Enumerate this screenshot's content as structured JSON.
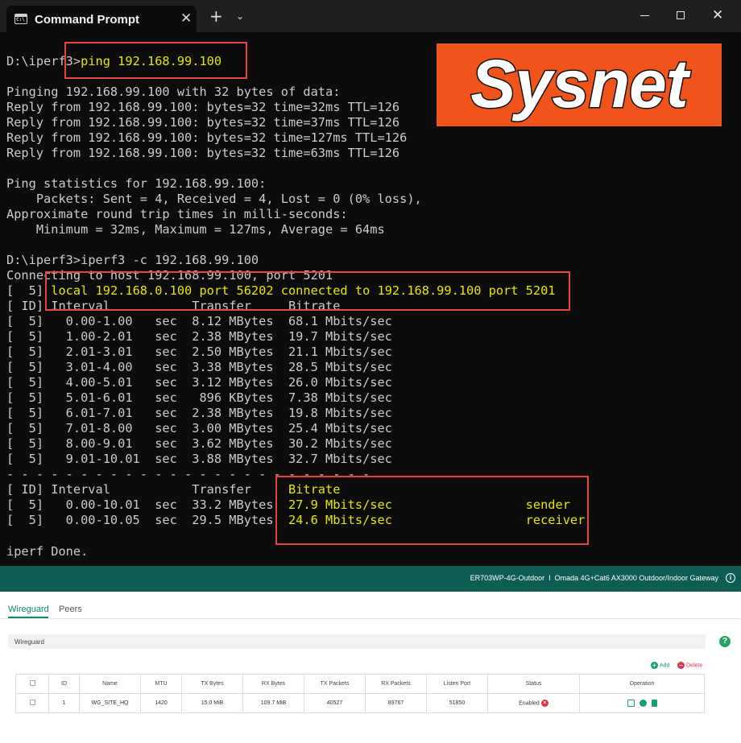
{
  "window": {
    "tab_title": "Command Prompt",
    "tab_icon_text": "C:\\",
    "close_tab_glyph": "✕",
    "new_tab_glyph": "+",
    "dropdown_glyph": "⌄",
    "close_window_glyph": "✕"
  },
  "logo_text": "Sysnet",
  "terminal": {
    "ping_prompt": "D:\\iperf3>",
    "ping_cmd": "ping 192.168.99.100",
    "pinging": "Pinging 192.168.99.100 with 32 bytes of data:",
    "replies": [
      "Reply from 192.168.99.100: bytes=32 time=32ms TTL=126",
      "Reply from 192.168.99.100: bytes=32 time=37ms TTL=126",
      "Reply from 192.168.99.100: bytes=32 time=127ms TTL=126",
      "Reply from 192.168.99.100: bytes=32 time=63ms TTL=126"
    ],
    "stats_header": "Ping statistics for 192.168.99.100:",
    "packets": "    Packets: Sent = 4, Received = 4, Lost = 0 (0% loss),",
    "approx": "Approximate round trip times in milli-seconds:",
    "minmax": "    Minimum = 32ms, Maximum = 127ms, Average = 64ms",
    "iperf_prompt": "D:\\iperf3>",
    "iperf_cmd": "iperf3 -c 192.168.99.100",
    "connecting": "Connecting to host 192.168.99.100, port 5201",
    "local_prefix": "[  5] ",
    "local_line": "local 192.168.0.100 port 56202 connected to 192.168.99.100 port 5201",
    "col_header": "[ ID] Interval           Transfer     Bitrate",
    "intervals": [
      "[  5]   0.00-1.00   sec  8.12 MBytes  68.1 Mbits/sec",
      "[  5]   1.00-2.01   sec  2.38 MBytes  19.7 Mbits/sec",
      "[  5]   2.01-3.01   sec  2.50 MBytes  21.1 Mbits/sec",
      "[  5]   3.01-4.00   sec  3.38 MBytes  28.5 Mbits/sec",
      "[  5]   4.00-5.01   sec  3.12 MBytes  26.0 Mbits/sec",
      "[  5]   5.01-6.01   sec   896 KBytes  7.38 Mbits/sec",
      "[  5]   6.01-7.01   sec  2.38 MBytes  19.8 Mbits/sec",
      "[  5]   7.01-8.00   sec  3.00 MBytes  25.4 Mbits/sec",
      "[  5]   8.00-9.01   sec  3.62 MBytes  30.2 Mbits/sec",
      "[  5]   9.01-10.01  sec  3.88 MBytes  32.7 Mbits/sec"
    ],
    "divider": "- - - - - - - - - - - - - - - - - - - - - - - - -",
    "summary_header_prefix": "[ ID] Interval           Transfer     ",
    "summary_header_bitrate": "Bitrate",
    "sender_prefix": "[  5]   0.00-10.01  sec  33.2 MBytes  ",
    "sender_rate": "27.9 Mbits/sec                  sender",
    "receiver_prefix": "[  5]   0.00-10.05  sec  29.5 MBytes  ",
    "receiver_rate": "24.6 Mbits/sec                  receiver",
    "done": "iperf Done."
  },
  "web": {
    "device_title": "ER703WP-4G-Outdoor  I  Omada 4G+Cat6 AX3000 Outdoor/Indoor Gateway",
    "info_glyph": "i",
    "tabs": [
      "Wireguard",
      "Peers"
    ],
    "panel_title": "Wireguard",
    "help_glyph": "?",
    "add_label": "Add",
    "delete_label": "Delete",
    "add_glyph": "+",
    "delete_glyph": "−",
    "columns": [
      "ID",
      "Name",
      "MTU",
      "TX Bytes",
      "RX Bytes",
      "TX Packets",
      "RX Packets",
      "Listen Port",
      "Status",
      "Operation"
    ],
    "row": {
      "id": "1",
      "name": "WG_SITE_HQ",
      "mtu": "1420",
      "tx_bytes": "15.0 MiB",
      "rx_bytes": "109.7 MiB",
      "tx_packets": "40527",
      "rx_packets": "89767",
      "listen_port": "51850",
      "status": "Enabled",
      "status_glyph": "×"
    }
  }
}
